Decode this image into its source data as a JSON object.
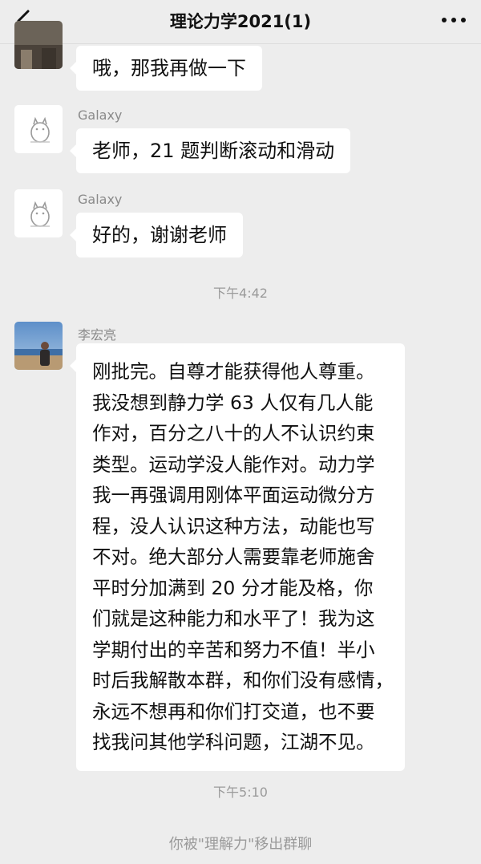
{
  "header": {
    "title": "理论力学2021(1)",
    "back_icon": "chevron-left-icon",
    "more_icon": "more-dots-icon"
  },
  "messages": [
    {
      "sender": "",
      "text": "哦，那我再做一下",
      "avatar": "photo-avatar"
    },
    {
      "sender": "Galaxy",
      "text": "老师，21 题判断滚动和滑动",
      "avatar": "totoro-avatar"
    },
    {
      "sender": "Galaxy",
      "text": "好的，谢谢老师",
      "avatar": "totoro-avatar"
    }
  ],
  "timestamps": [
    "下午4:42",
    "下午5:10"
  ],
  "long_message": {
    "sender": "李宏亮",
    "avatar": "photo-avatar",
    "lines": [
      "刚批完。自尊才能获得他人尊重。",
      "我没想到静力学 63 人仅有几人能",
      "作对，百分之八十的人不认识约束",
      "类型。运动学没人能作对。动力学",
      "我一再强调用刚体平面运动微分方",
      "程，没人认识这种方法，动能也写",
      "不对。绝大部分人需要靠老师施舍",
      "平时分加满到 20 分才能及格，你",
      "们就是这种能力和水平了！我为这",
      "学期付出的辛苦和努力不值！半小",
      "时后我解散本群，和你们没有感情，",
      "永远不想再和你们打交道，也不要",
      "找我问其他学科问题，江湖不见。"
    ]
  },
  "system_message": "你被\"理解力\"移出群聊",
  "colors": {
    "background": "#ededed",
    "bubble": "#ffffff",
    "meta_text": "#9a9a9a"
  }
}
